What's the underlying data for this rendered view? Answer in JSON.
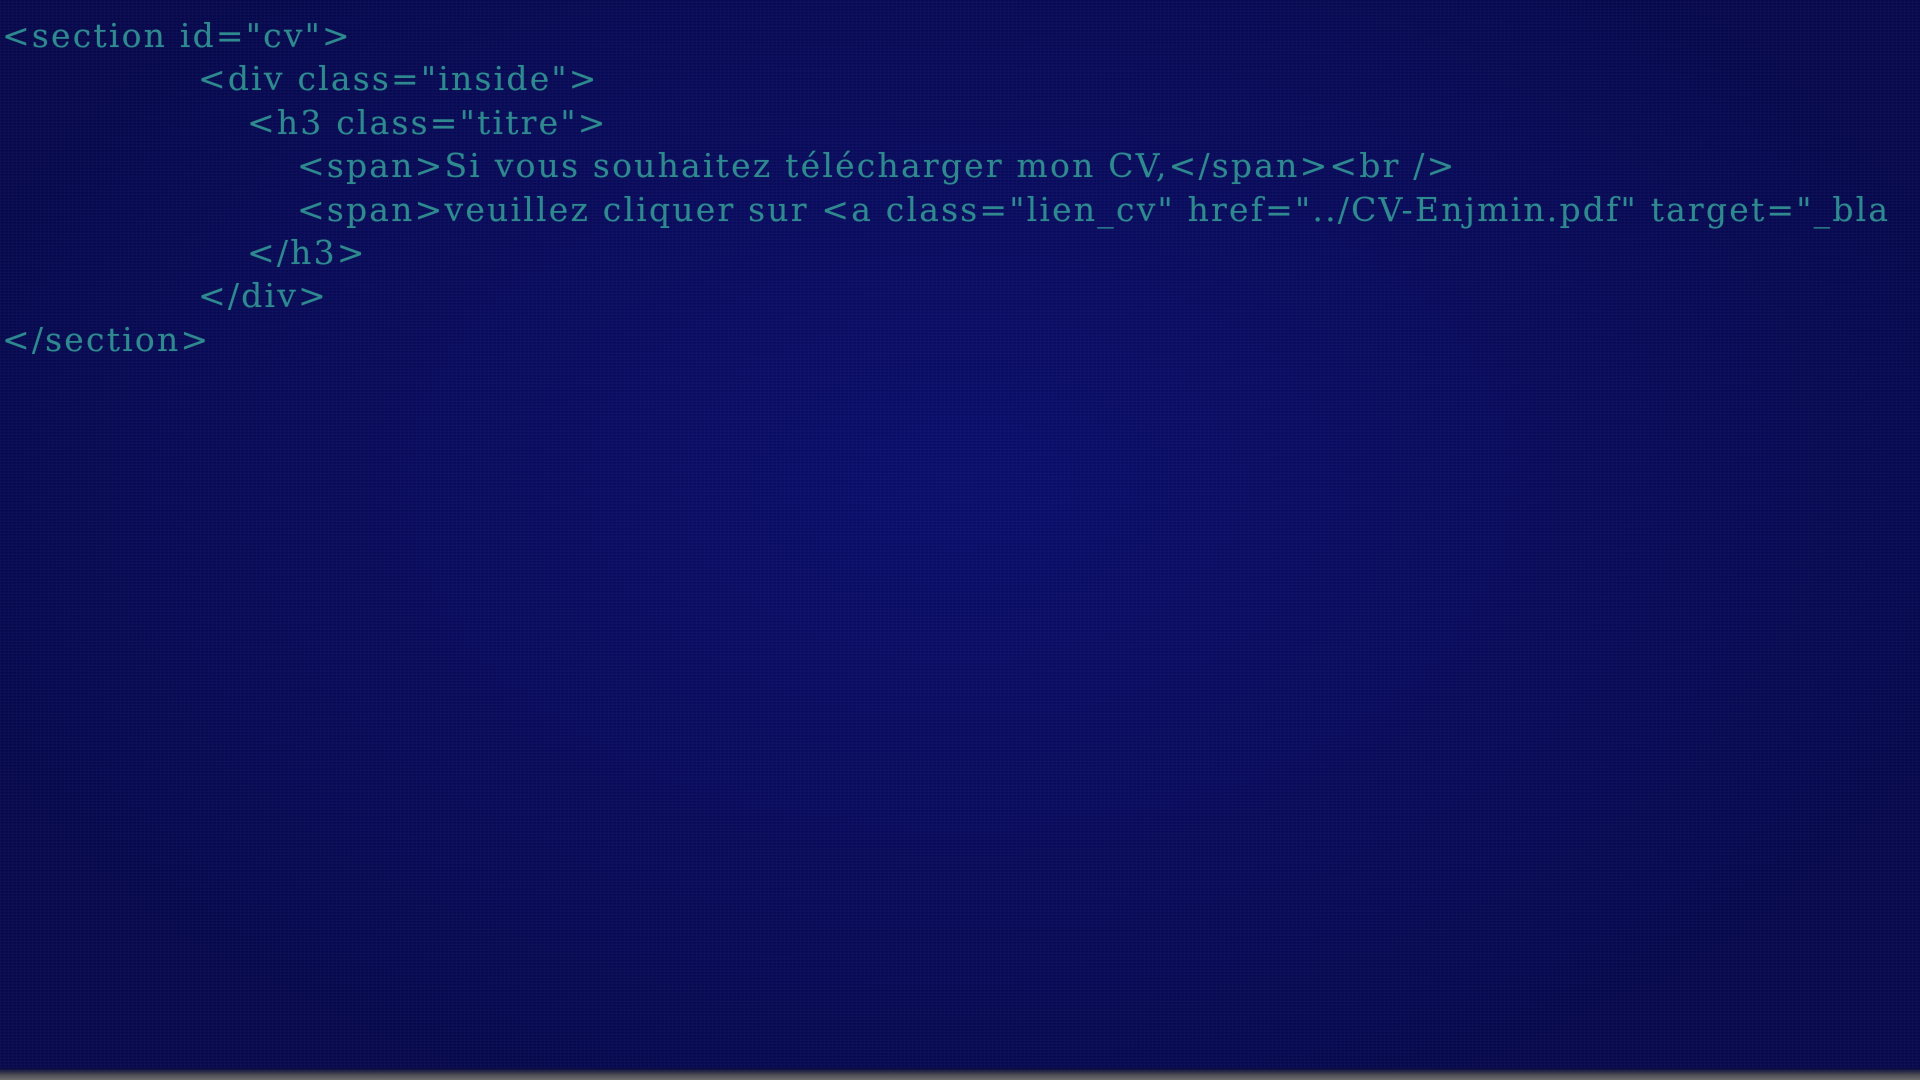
{
  "code_view": {
    "lines": [
      "<section id=\"cv\">",
      "<div class=\"inside\">",
      "<h3 class=\"titre\">",
      "<span>Si vous souhaitez télécharger mon CV,</span><br />",
      "<span>veuillez cliquer sur <a class=\"lien_cv\" href=\"../CV-Enjmin.pdf\" target=\"_bla",
      "</h3>",
      "</div>",
      "</section>"
    ]
  },
  "colors": {
    "background": "#07095a",
    "text": "#2e8a8f"
  }
}
